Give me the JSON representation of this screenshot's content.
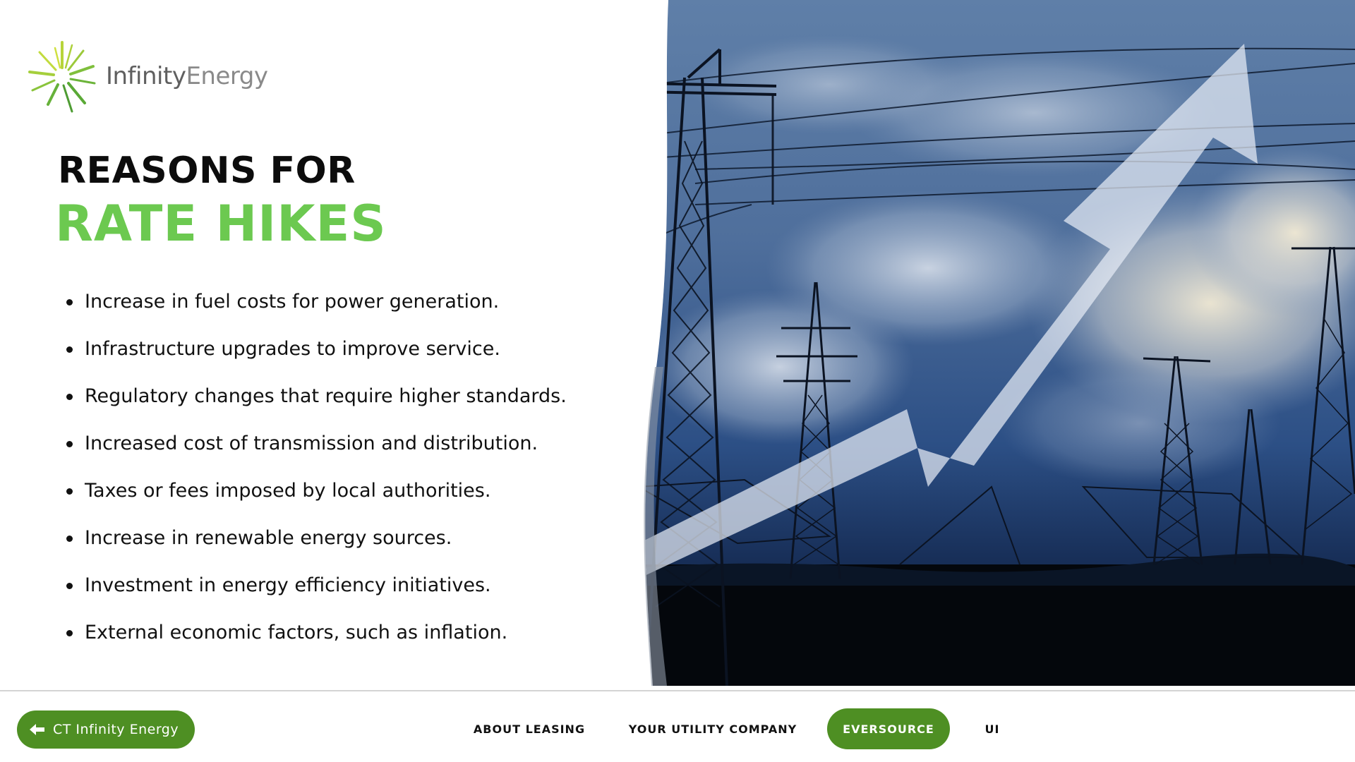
{
  "brand": {
    "name_strong": "Infinity",
    "name_light": "Energy",
    "accent_color": "#6cc950",
    "button_color": "#4e8f23"
  },
  "heading": {
    "line1": "REASONS FOR",
    "line2": "RATE HIKES"
  },
  "reasons": [
    "Increase in fuel costs for power generation.",
    "Infrastructure upgrades to improve service.",
    "Regulatory changes that require higher standards.",
    "Increased cost of transmission and distribution.",
    "Taxes or fees imposed by local authorities.",
    "Increase in renewable energy sources.",
    "Investment in energy efficiency initiatives.",
    "External economic factors, such as inflation."
  ],
  "footer": {
    "back_button": {
      "label": "CT Infinity Energy",
      "icon": "arrow-left-icon"
    },
    "nav": {
      "about": "ABOUT LEASING",
      "utility": "YOUR UTILITY COMPANY",
      "active": "EVERSOURCE",
      "ui": "UI"
    }
  },
  "image": {
    "subject": "power-lines-with-rising-arrow"
  }
}
